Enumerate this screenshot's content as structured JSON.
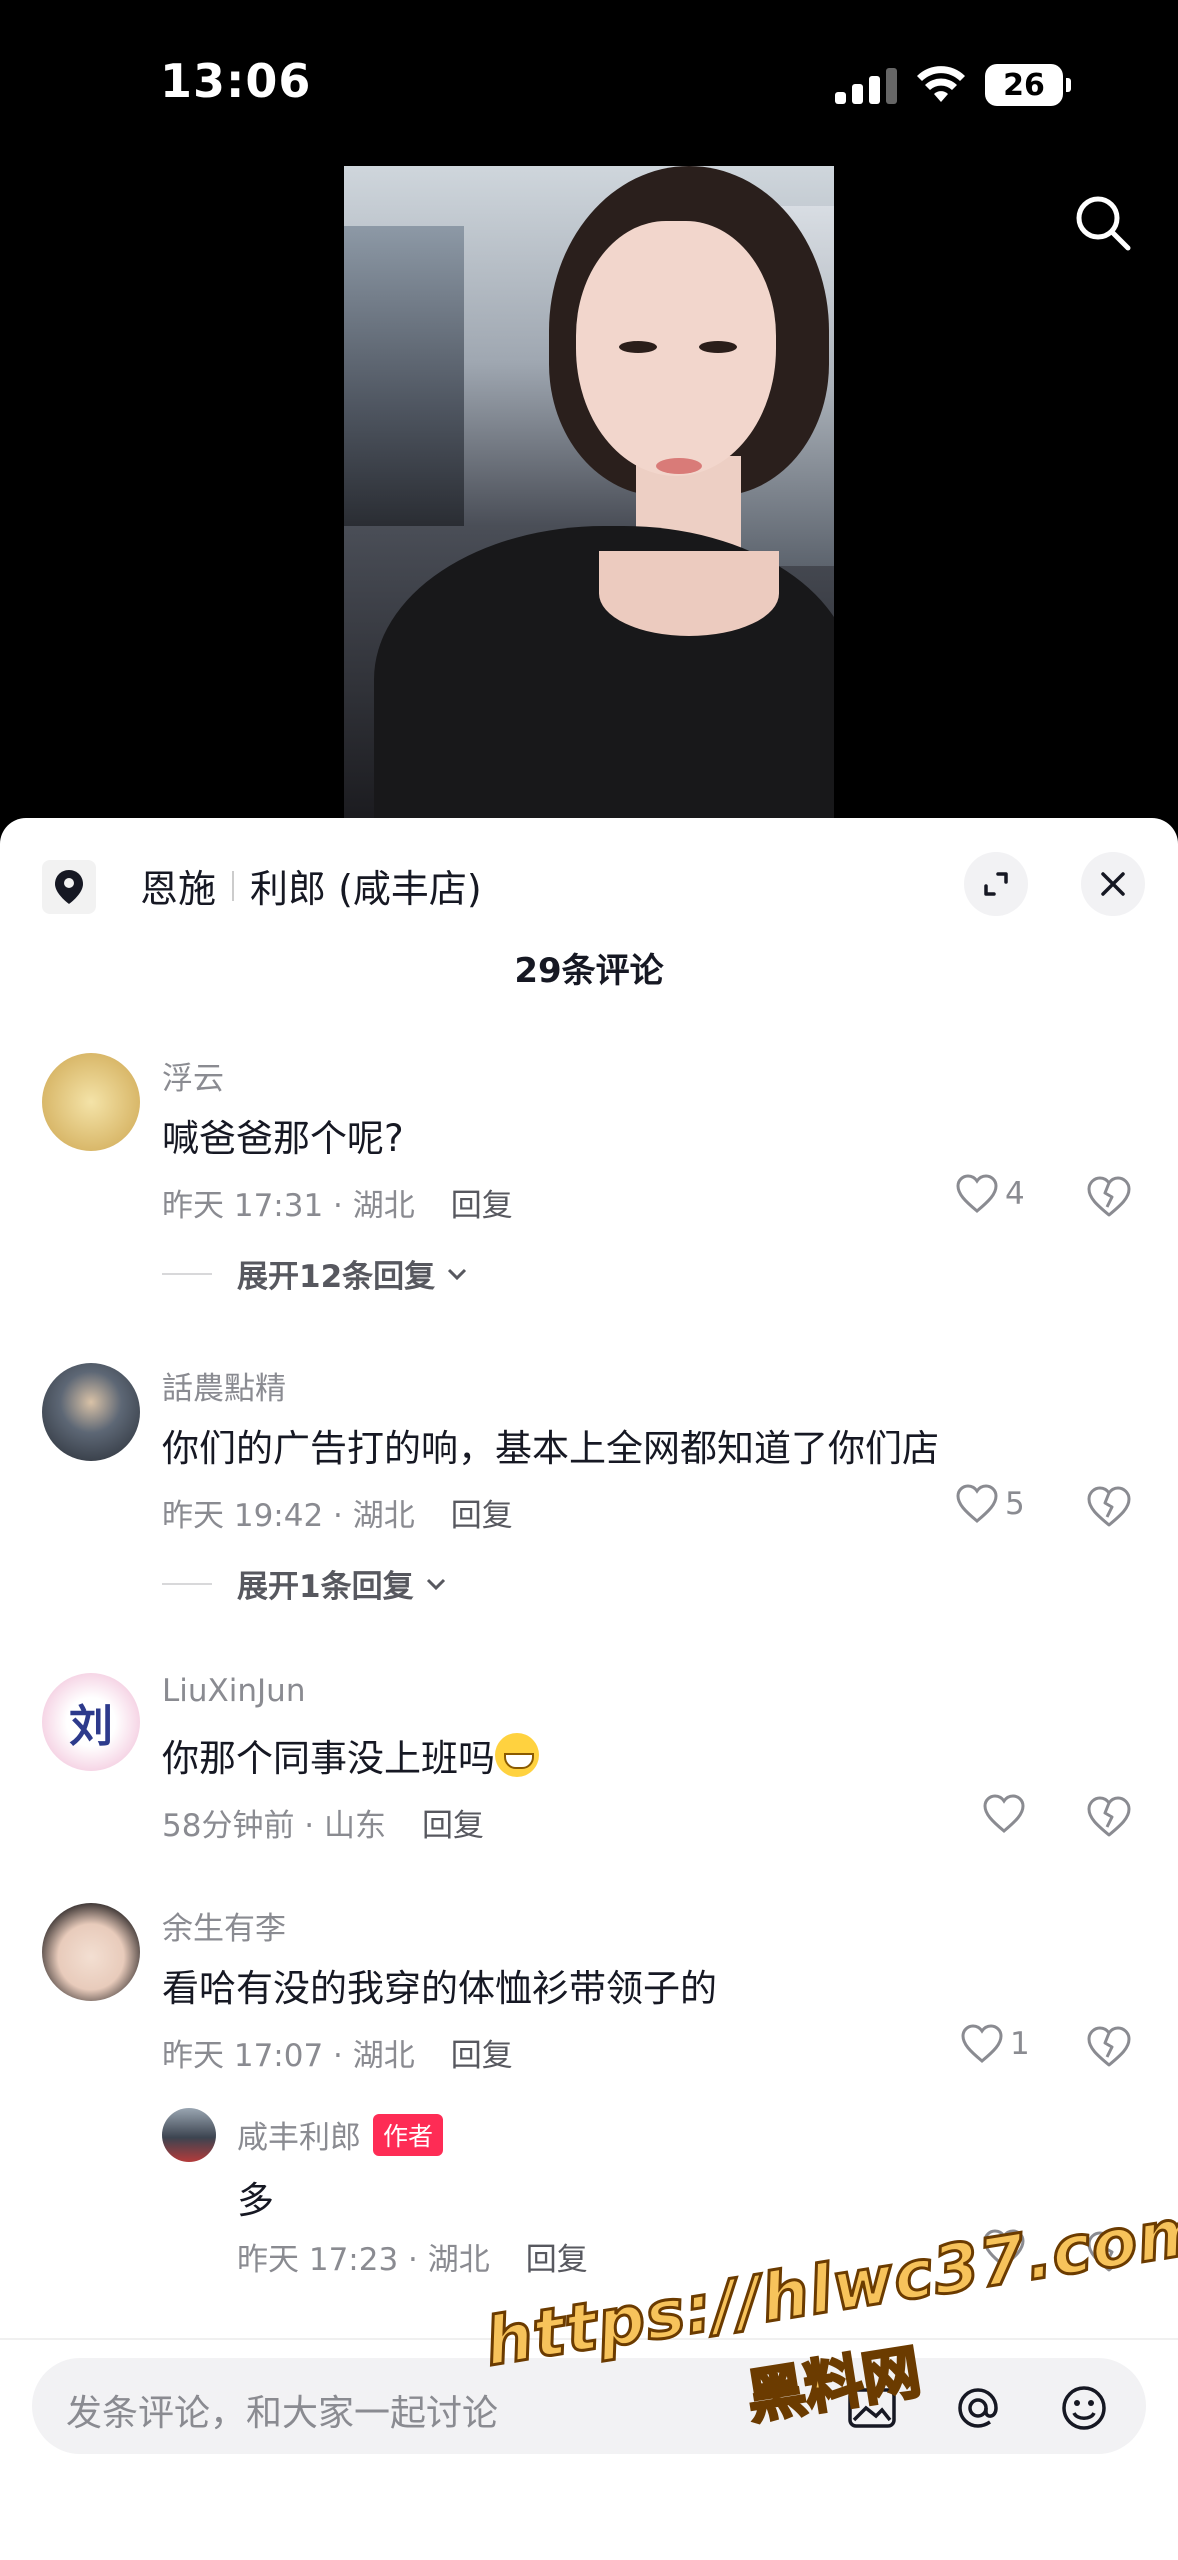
{
  "status": {
    "time": "13:06",
    "battery": "26"
  },
  "location": {
    "city": "恩施",
    "shop": "利郎 (咸丰店)"
  },
  "comment_count": "29条评论",
  "comments": [
    {
      "user": "浮云",
      "text": "喊爸爸那个呢?",
      "time": "昨天 17:31 · 湖北",
      "reply": "回复",
      "likes": "4",
      "expand": "展开12条回复"
    },
    {
      "user": "話農點精",
      "text": "你们的广告打的响，基本上全网都知道了你们店",
      "time": "昨天 19:42 · 湖北",
      "reply": "回复",
      "likes": "5",
      "expand": "展开1条回复"
    },
    {
      "user": "LiuXinJun",
      "text": "你那个同事没上班吗",
      "time": "58分钟前 · 山东",
      "reply": "回复",
      "likes": ""
    },
    {
      "user": "余生有李",
      "text": "看哈有没的我穿的体恤衫带领子的",
      "time": "昨天 17:07 · 湖北",
      "reply": "回复",
      "likes": "1"
    }
  ],
  "reply": {
    "user": "咸丰利郎",
    "badge": "作者",
    "text": "多",
    "time": "昨天 17:23 · 湖北",
    "reply": "回复"
  },
  "avatar_text": "刘",
  "input": {
    "placeholder": "发条评论，和大家一起讨论"
  },
  "watermark": {
    "url": "https://hlwc37.com",
    "name": "黑料网"
  },
  "colors": {
    "accent": "#fe2c55",
    "text": "#161823",
    "secondary": "#8a8b91",
    "watermark": "#f7c35b"
  }
}
